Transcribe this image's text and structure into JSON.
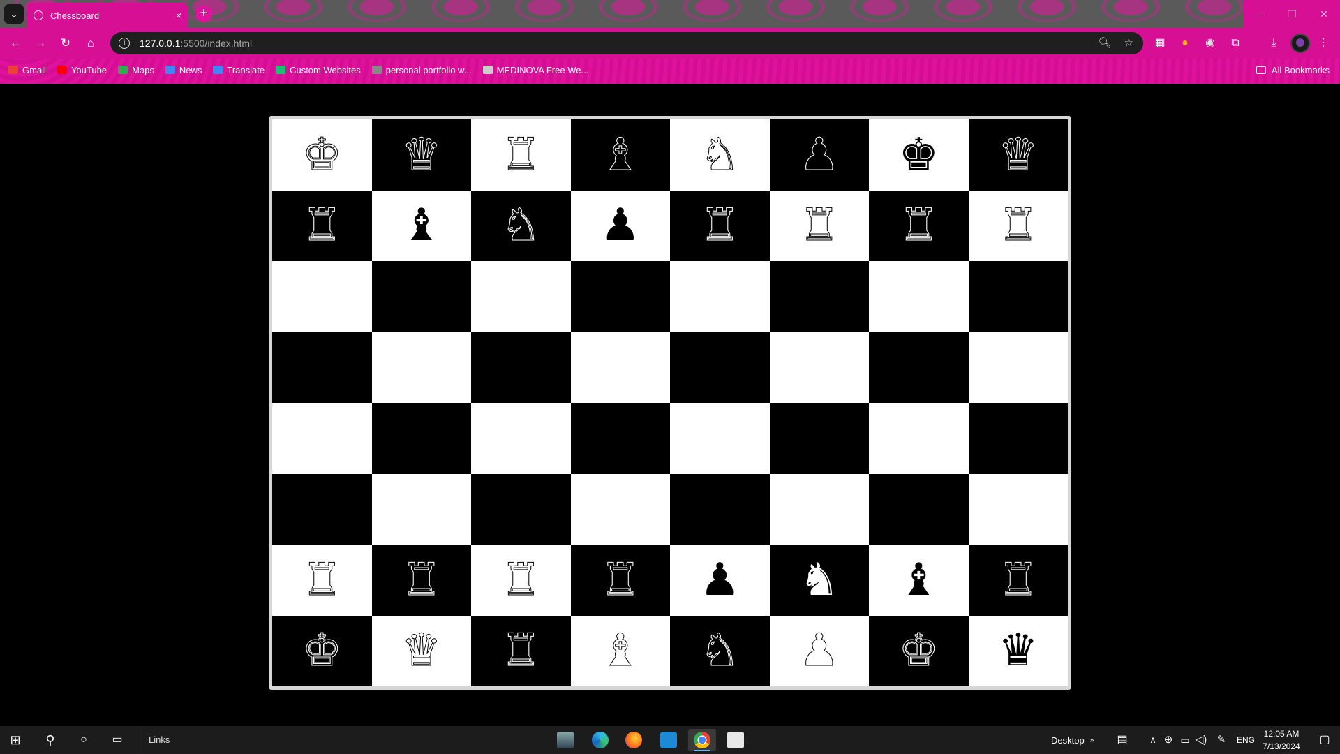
{
  "browser": {
    "tab_title": "Chessboard",
    "tab_close": "×",
    "new_tab": "+",
    "url_host": "127.0.0.1",
    "url_path": ":5500/index.html",
    "window_controls": [
      "–",
      "❐",
      "✕"
    ]
  },
  "bookmarks": [
    {
      "label": "Gmail",
      "icon": "gmail-icon",
      "color": "#ea4335"
    },
    {
      "label": "YouTube",
      "icon": "youtube-icon",
      "color": "#ff0000"
    },
    {
      "label": "Maps",
      "icon": "maps-icon",
      "color": "#34a853"
    },
    {
      "label": "News",
      "icon": "news-icon",
      "color": "#4285f4"
    },
    {
      "label": "Translate",
      "icon": "translate-icon",
      "color": "#4285f4"
    },
    {
      "label": "Custom Websites",
      "icon": "fiverr-icon",
      "color": "#1dbf73"
    },
    {
      "label": "personal portfolio w...",
      "icon": "globe-icon",
      "color": "#888888"
    },
    {
      "label": "MEDINOVA Free We...",
      "icon": "site-icon",
      "color": "#cccccc"
    }
  ],
  "all_bookmarks": "All Bookmarks",
  "board": {
    "rows": [
      [
        "K",
        "Q",
        "R",
        "B",
        "N",
        "P",
        "K",
        "Q"
      ],
      [
        "R",
        "B",
        "N",
        "P",
        "R",
        "R",
        "R",
        "R"
      ],
      [
        "",
        "",
        "",
        "",
        "",
        "",
        "",
        ""
      ],
      [
        "",
        "",
        "",
        "",
        "",
        "",
        "",
        ""
      ],
      [
        "",
        "",
        "",
        "",
        "",
        "",
        "",
        ""
      ],
      [
        "",
        "",
        "",
        "",
        "",
        "",
        "",
        ""
      ],
      [
        "R",
        "R",
        "R",
        "R",
        "P",
        "N",
        "B",
        "R"
      ],
      [
        "K",
        "Q",
        "R",
        "B",
        "N",
        "P",
        "K",
        "Q"
      ]
    ],
    "colors": [
      [
        "w",
        "w",
        "w",
        "w",
        "w",
        "w",
        "b",
        "w"
      ],
      [
        "w",
        "b",
        "w",
        "b",
        "w",
        "w",
        "w",
        "w"
      ],
      [
        "",
        "",
        "",
        "",
        "",
        "",
        "",
        ""
      ],
      [
        "",
        "",
        "",
        "",
        "",
        "",
        "",
        ""
      ],
      [
        "",
        "",
        "",
        "",
        "",
        "",
        "",
        ""
      ],
      [
        "",
        "",
        "",
        "",
        "",
        "",
        "",
        ""
      ],
      [
        "w",
        "w",
        "w",
        "w",
        "b",
        "b",
        "b",
        "w"
      ],
      [
        "w",
        "w",
        "w",
        "w",
        "w",
        "w",
        "w",
        "b"
      ]
    ]
  },
  "taskbar": {
    "links_label": "Links",
    "desktop_label": "Desktop",
    "language": "ENG",
    "time": "12:05 AM",
    "date": "7/13/2024"
  }
}
